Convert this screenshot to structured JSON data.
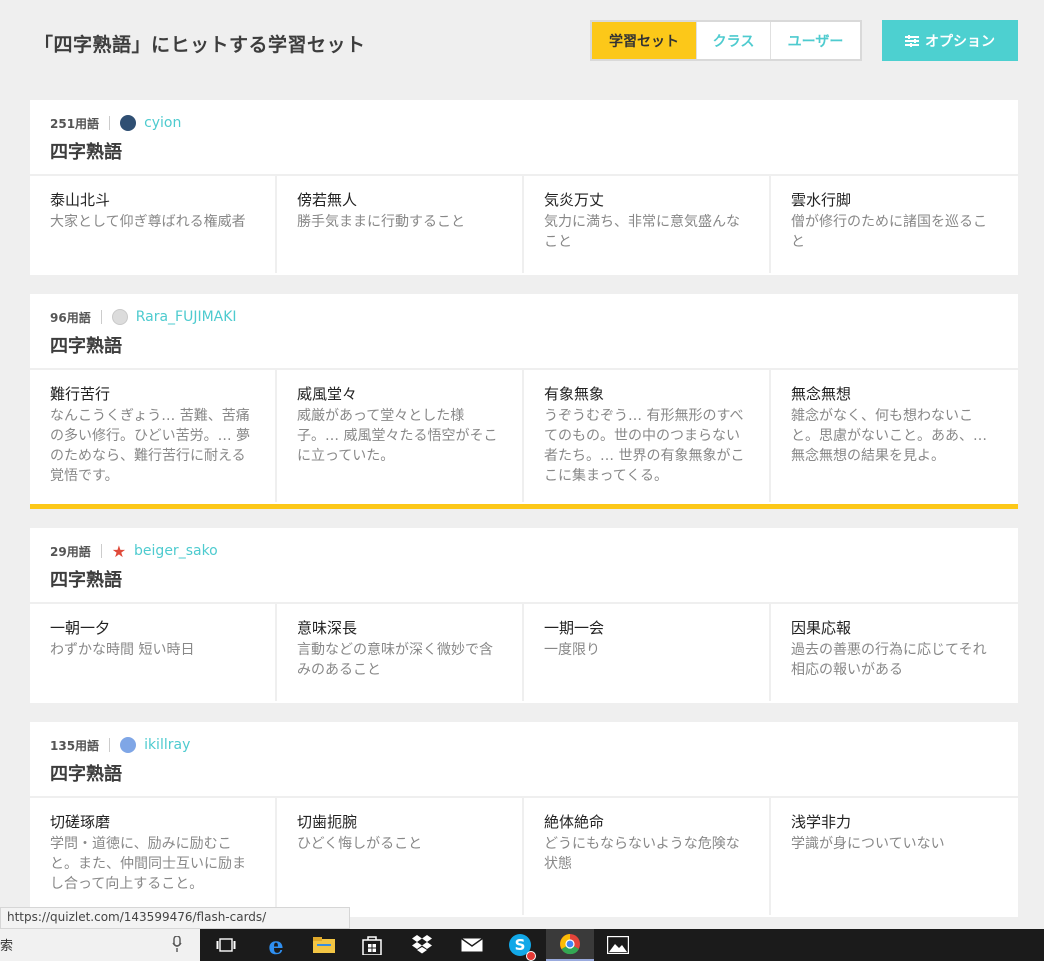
{
  "header": {
    "title": "「四字熟語」にヒットする学習セット",
    "tabs": [
      {
        "label": "学習セット"
      },
      {
        "label": "クラス"
      },
      {
        "label": "ユーザー"
      }
    ],
    "options_label": "オプション"
  },
  "sets": [
    {
      "count": "251用語",
      "user": "cyion",
      "title": "四字熟語",
      "terms": [
        {
          "word": "泰山北斗",
          "def": "大家として仰ぎ尊ばれる権威者"
        },
        {
          "word": "傍若無人",
          "def": "勝手気ままに行動すること"
        },
        {
          "word": "気炎万丈",
          "def": "気力に満ち、非常に意気盛んなこと"
        },
        {
          "word": "雲水行脚",
          "def": "僧が修行のために諸国を巡ること"
        }
      ]
    },
    {
      "count": "96用語",
      "user": "Rara_FUJIMAKI",
      "title": "四字熟語",
      "terms": [
        {
          "word": "難行苦行",
          "def": "なんこうくぎょう… 苦難、苦痛の多い修行。ひどい苦労。… 夢のためなら、難行苦行に耐える覚悟です。"
        },
        {
          "word": "威風堂々",
          "def": "威厳があって堂々とした様子。… 威風堂々たる悟空がそこに立っていた。"
        },
        {
          "word": "有象無象",
          "def": "うぞうむぞう… 有形無形のすべてのもの。世の中のつまらない者たち。… 世界の有象無象がここに集まってくる。"
        },
        {
          "word": "無念無想",
          "def": "雑念がなく、何も想わないこと。思慮がないこと。ああ、… 無念無想の結果を見よ。"
        }
      ]
    },
    {
      "count": "29用語",
      "user": "beiger_sako",
      "title": "四字熟語",
      "terms": [
        {
          "word": "一朝一夕",
          "def": "わずかな時間 短い時日"
        },
        {
          "word": "意味深長",
          "def": "言動などの意味が深く微妙で含みのあること"
        },
        {
          "word": "一期一会",
          "def": "一度限り"
        },
        {
          "word": "因果応報",
          "def": "過去の善悪の行為に応じてそれ相応の報いがある"
        }
      ]
    },
    {
      "count": "135用語",
      "user": "ikillray",
      "title": "四字熟語",
      "terms": [
        {
          "word": "切磋琢磨",
          "def": "学問・道徳に、励みに励むこと。また、仲間同士互いに励まし合って向上すること。"
        },
        {
          "word": "切歯扼腕",
          "def": "ひどく悔しがること"
        },
        {
          "word": "絶体絶命",
          "def": "どうにもならないような危険な状態"
        },
        {
          "word": "浅学非力",
          "def": "学識が身についていない"
        }
      ]
    }
  ],
  "status_url": "https://quizlet.com/143599476/flash-cards/",
  "taskbar": {
    "search_fragment": "索"
  },
  "colors": {
    "accent_yellow": "#fcc819",
    "accent_teal": "#4dd0d0"
  }
}
